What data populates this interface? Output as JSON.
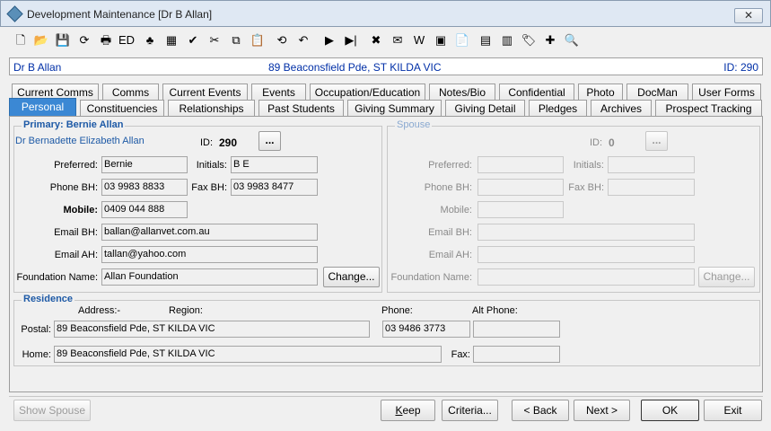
{
  "window": {
    "title": "Development Maintenance  [Dr B Allan]",
    "close_label": "✕"
  },
  "infobar": {
    "name": "Dr B Allan",
    "address": "89 Beaconsfield Pde, ST KILDA VIC",
    "id": "ID: 290"
  },
  "tabs_row1": [
    "Current Comms",
    "Comms",
    "Current Events",
    "Events",
    "Occupation/Education",
    "Notes/Bio",
    "Confidential",
    "Photo",
    "DocMan",
    "User Forms"
  ],
  "tabs_row2": [
    "Personal",
    "Constituencies",
    "Relationships",
    "Past Students",
    "Giving Summary",
    "Giving Detail",
    "Pledges",
    "Archives",
    "Prospect Tracking"
  ],
  "primary": {
    "title": "Primary: Bernie Allan",
    "full_name": "Dr Bernadette Elizabeth Allan",
    "id_label": "ID:",
    "id_value": "290",
    "ellipsis": "...",
    "preferred_label": "Preferred:",
    "preferred": "Bernie",
    "initials_label": "Initials:",
    "initials": "B E",
    "phone_bh_label": "Phone BH:",
    "phone_bh": "03 9983 8833",
    "fax_bh_label": "Fax BH:",
    "fax_bh": "03 9983 8477",
    "mobile_label": "Mobile:",
    "mobile": "0409 044 888",
    "email_bh_label": "Email BH:",
    "email_bh": "ballan@allanvet.com.au",
    "email_ah_label": "Email AH:",
    "email_ah": "tallan@yahoo.com",
    "foundation_label": "Foundation Name:",
    "foundation": "Allan Foundation",
    "change_label": "Change..."
  },
  "spouse": {
    "title": "Spouse",
    "id_label": "ID:",
    "id_value": "0",
    "ellipsis": "...",
    "preferred_label": "Preferred:",
    "initials_label": "Initials:",
    "phone_bh_label": "Phone BH:",
    "fax_bh_label": "Fax BH:",
    "mobile_label": "Mobile:",
    "email_bh_label": "Email BH:",
    "email_ah_label": "Email AH:",
    "foundation_label": "Foundation Name:",
    "change_label": "Change..."
  },
  "residence": {
    "title": "Residence",
    "address_label": "Address:-",
    "region_label": "Region:",
    "phone_label": "Phone:",
    "alt_phone_label": "Alt Phone:",
    "postal_label": "Postal:",
    "postal": "89 Beaconsfield Pde, ST KILDA VIC",
    "postal_phone": "03 9486 3773",
    "home_label": "Home:",
    "home": "89 Beaconsfield Pde, ST KILDA VIC",
    "fax_label": "Fax:"
  },
  "buttons": {
    "show_spouse": "Show Spouse",
    "keep": "Keep",
    "criteria": "Criteria...",
    "back": "< Back",
    "next": "Next >",
    "ok": "OK",
    "exit": "Exit"
  },
  "toolbar_icons": [
    "new-icon",
    "open-icon",
    "save-icon",
    "refresh-icon",
    "print-icon",
    "edit-icon",
    "tree-icon",
    "calculator-icon",
    "spellcheck-icon",
    "cut-icon",
    "copy-icon",
    "paste-icon",
    "first-icon",
    "prev-icon",
    "next-icon",
    "last-icon",
    "delete-icon",
    "email-icon",
    "word-icon",
    "merge-icon",
    "report-icon",
    "calendar-icon",
    "event-icon",
    "tag-icon",
    "addnote-icon",
    "preview-icon"
  ],
  "toolbar_glyphs": [
    "🗋",
    "📂",
    "💾",
    "⟳",
    "🖶",
    "ED",
    "♣",
    "▦",
    "✔",
    "✂",
    "⧉",
    "📋",
    "⟲",
    "↶",
    "▶",
    "▶|",
    "✖",
    "✉",
    "W",
    "▣",
    "📄",
    "▤",
    "▥",
    "🏷",
    "✚",
    "🔍"
  ],
  "colors": {
    "accent": "#3b88d4",
    "info_text": "#002fa7",
    "group_title": "#1e5aa6"
  }
}
